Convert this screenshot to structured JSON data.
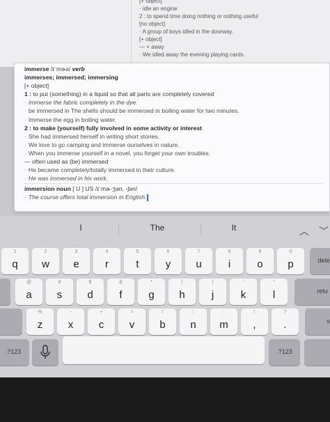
{
  "document": {
    "lines": [
      {
        "text": "[+ object]",
        "bullet": false
      },
      {
        "text": "idle an engine",
        "bullet": true
      },
      {
        "text": "2 : to spend time doing nothing or nothing useful",
        "bullet": false
      },
      {
        "text": "[no object]",
        "bullet": false
      },
      {
        "text": "A group of boys idled in the doorway.",
        "bullet": true
      },
      {
        "text": "[+ object]",
        "bullet": false
      },
      {
        "text": "— + away",
        "bullet": false
      },
      {
        "text": "We idled away the evening playing cards.",
        "bullet": true
      }
    ]
  },
  "popover": {
    "headword": "immerse",
    "pron": "/ɪˈmɚs/",
    "pos": "verb",
    "forms": "immerses; immersed; immersing",
    "obj1": "[+ object]",
    "sense1_num": "1 :",
    "sense1": "to put (something) in a liquid so that all parts are completely covered",
    "ex1": "Immerse the fabric completely in the dye.",
    "ex2": "be immersed in The shells should be immersed in boiling water for two minutes.",
    "ex3": "Immerse the egg in boiling water.",
    "sense2_num": "2 :",
    "sense2": "to make (yourself) fully involved in some activity or interest",
    "ex4": "She had immersed herself in writing short stories.",
    "ex5": "We love to go camping and immerse ourselves in nature.",
    "ex6": "When you immerse yourself in a novel, you forget your own troubles.",
    "usage": "— often used as (be) immersed",
    "ex7": "He became completely/totally immersed in their culture.",
    "ex8": "He was immersed in his work.",
    "noun_head": "immersion noun",
    "noun_info": "[ U ] US /ɪˈmɚ·ʒən, -ʃən/",
    "ex9": "The course offers total immersion in English."
  },
  "keyboard": {
    "predictions": [
      "I",
      "The",
      "It"
    ],
    "row1": [
      {
        "hint": "1",
        "ch": "q"
      },
      {
        "hint": "2",
        "ch": "w"
      },
      {
        "hint": "3",
        "ch": "e"
      },
      {
        "hint": "4",
        "ch": "r"
      },
      {
        "hint": "5",
        "ch": "t"
      },
      {
        "hint": "6",
        "ch": "y"
      },
      {
        "hint": "7",
        "ch": "u"
      },
      {
        "hint": "8",
        "ch": "i"
      },
      {
        "hint": "9",
        "ch": "o"
      },
      {
        "hint": "0",
        "ch": "p"
      }
    ],
    "delete_label": "dele",
    "row2": [
      {
        "hint": "@",
        "ch": "a"
      },
      {
        "hint": "#",
        "ch": "s"
      },
      {
        "hint": "$",
        "ch": "d"
      },
      {
        "hint": "&",
        "ch": "f"
      },
      {
        "hint": "*",
        "ch": "g"
      },
      {
        "hint": "(",
        "ch": "h"
      },
      {
        "hint": ")",
        "ch": "j"
      },
      {
        "hint": "'",
        "ch": "k"
      },
      {
        "hint": "\"",
        "ch": "l"
      }
    ],
    "return_label": "retu",
    "row3": [
      {
        "hint": "%",
        "ch": "z"
      },
      {
        "hint": "-",
        "ch": "x"
      },
      {
        "hint": "+",
        "ch": "c"
      },
      {
        "hint": "=",
        "ch": "v"
      },
      {
        "hint": "/",
        "ch": "b"
      },
      {
        "hint": ";",
        "ch": "n"
      },
      {
        "hint": ":",
        "ch": "m"
      },
      {
        "hint": "!",
        "ch": ","
      },
      {
        "hint": "?",
        "ch": "."
      }
    ],
    "shift_label": "sł",
    "numbers_label": ".?123",
    "numbers_label_right": ".?123"
  }
}
